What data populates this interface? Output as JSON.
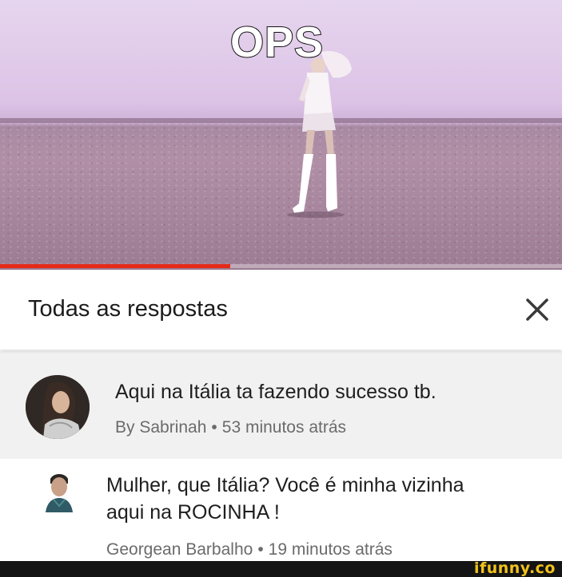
{
  "video": {
    "overlay_text": "OPS",
    "progress_fraction": 0.41,
    "progress_color": "#e52a18"
  },
  "header": {
    "title": "Todas as respostas",
    "close_icon": "close-x-icon"
  },
  "comments": [
    {
      "text": "Aqui na Itália ta fazendo sucesso tb.",
      "author": "By Sabrinah",
      "separator": "•",
      "time": "53 minutos atrás"
    },
    {
      "text_line1": "Mulher, que Itália? Você é minha vizinha",
      "text_line2": "aqui na ROCINHA !",
      "author": "Georgean Barbalho",
      "separator": "•",
      "time": "19 minutos atrás"
    }
  ],
  "watermark": {
    "brand": "ifunny.co",
    "color": "#f2c21b"
  }
}
